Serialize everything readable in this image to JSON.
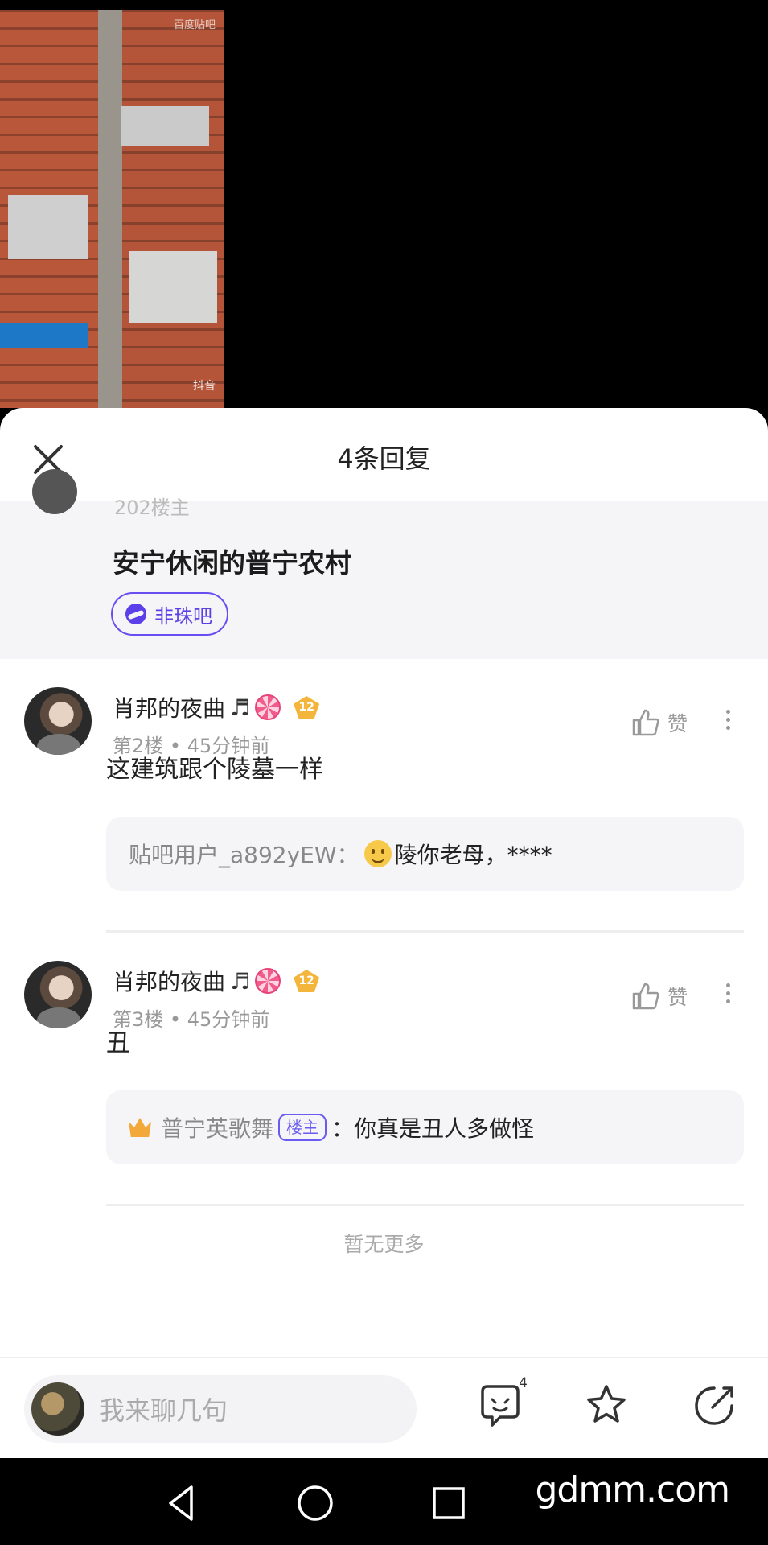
{
  "video": {
    "watermark_top": "百度贴吧",
    "watermark_bottom": "抖音"
  },
  "sheet": {
    "title": "4条回复"
  },
  "post": {
    "prev_snippet": "202楼主",
    "title": "安宁休闲的普宁农村",
    "forum": "非珠吧"
  },
  "replies": [
    {
      "username": "肖邦的夜曲",
      "level": "12",
      "floor": "第2楼",
      "time": "45分钟前",
      "content": "这建筑跟个陵墓一样",
      "like_label": "赞",
      "sub": {
        "author": "贴吧用户_a892yEW：",
        "text": "陵你老母，****"
      }
    },
    {
      "username": "肖邦的夜曲",
      "level": "12",
      "floor": "第3楼",
      "time": "45分钟前",
      "content": "丑",
      "like_label": "赞",
      "sub": {
        "author": "普宁英歌舞",
        "badge": "楼主",
        "colon": "：",
        "text": "你真是丑人多做怪"
      }
    }
  ],
  "end_text": "暂无更多",
  "bottom": {
    "placeholder": "我来聊几句",
    "reply_count": "4"
  },
  "site_watermark": "gdmm.com",
  "colors": {
    "accent": "#5b3fe8",
    "gold": "#f3b53b"
  },
  "icons": [
    "close-icon",
    "like-icon",
    "more-icon",
    "comment-icon",
    "star-icon",
    "share-icon",
    "back-icon",
    "home-icon",
    "recents-icon"
  ]
}
